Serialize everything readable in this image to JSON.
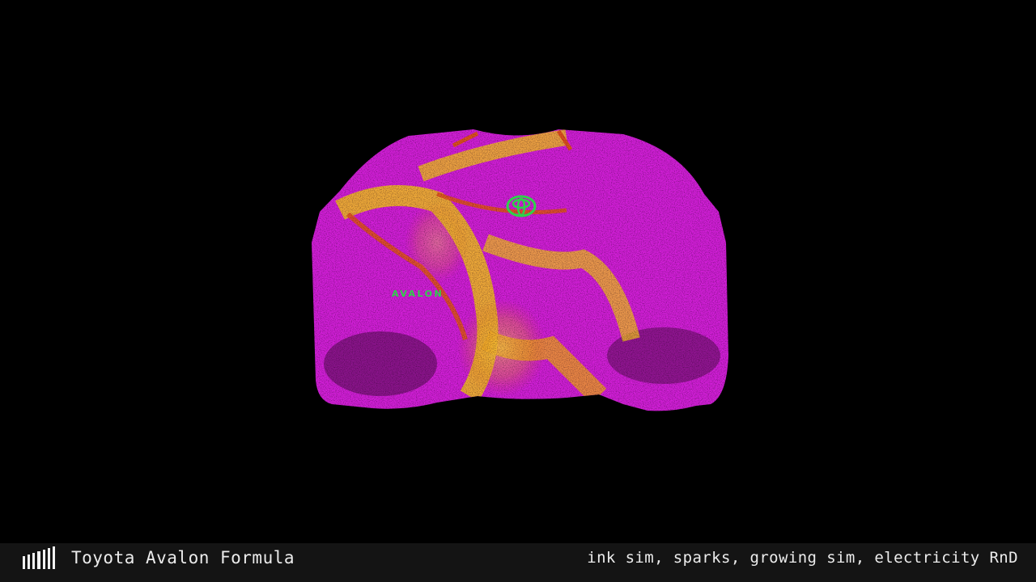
{
  "scene": {
    "subject": "car-rear-particle-render",
    "badge_text": "AVALON",
    "colors": {
      "body": "#d21fd8",
      "highlight": "#f2c41f",
      "edge": "#e0521e",
      "logo": "#2ed14a",
      "background": "#000000"
    }
  },
  "caption": {
    "title": "Toyota Avalon Formula",
    "tags": "ink sim, sparks, growing sim, electricity RnD",
    "logo_icon": "studio-bars-icon"
  }
}
